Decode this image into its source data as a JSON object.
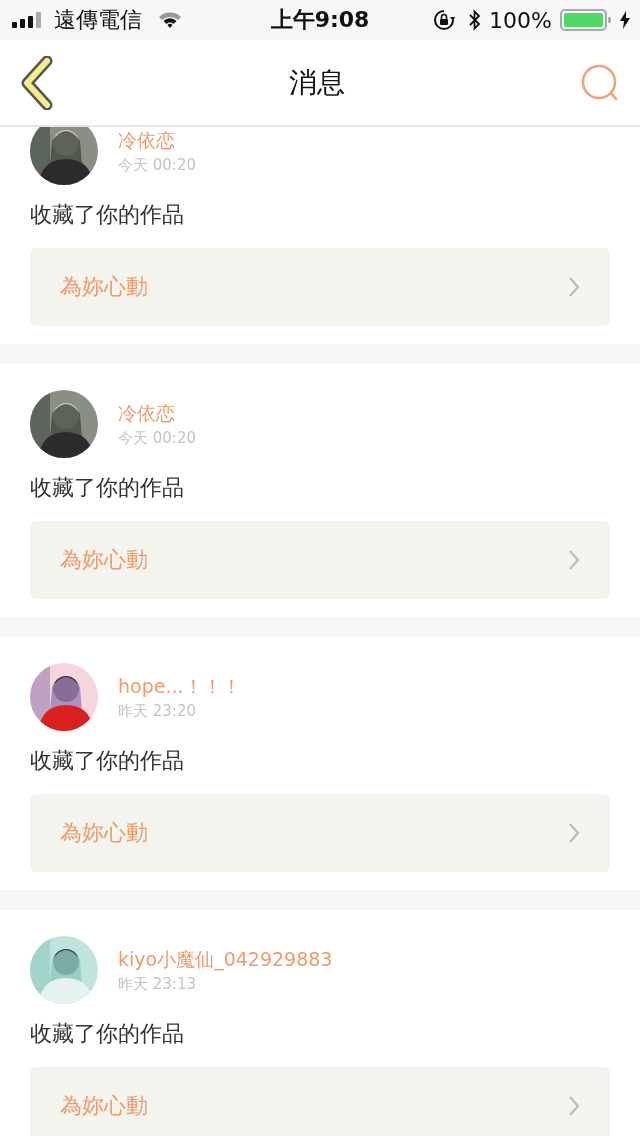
{
  "status_bar": {
    "carrier": "遠傳電信",
    "time": "上午9:08",
    "battery": "100%"
  },
  "nav": {
    "title": "消息"
  },
  "messages": [
    {
      "user": "冷依恋",
      "time": "今天 00:20",
      "action": "收藏了你的作品",
      "work": "為妳心動"
    },
    {
      "user": "冷依恋",
      "time": "今天 00:20",
      "action": "收藏了你的作品",
      "work": "為妳心動"
    },
    {
      "user": "hope...！！！",
      "time": "昨天 23:20",
      "action": "收藏了你的作品",
      "work": "為妳心動"
    },
    {
      "user": "kiyo小魔仙_042929883",
      "time": "昨天 23:13",
      "action": "收藏了你的作品",
      "work": "為妳心動"
    }
  ]
}
